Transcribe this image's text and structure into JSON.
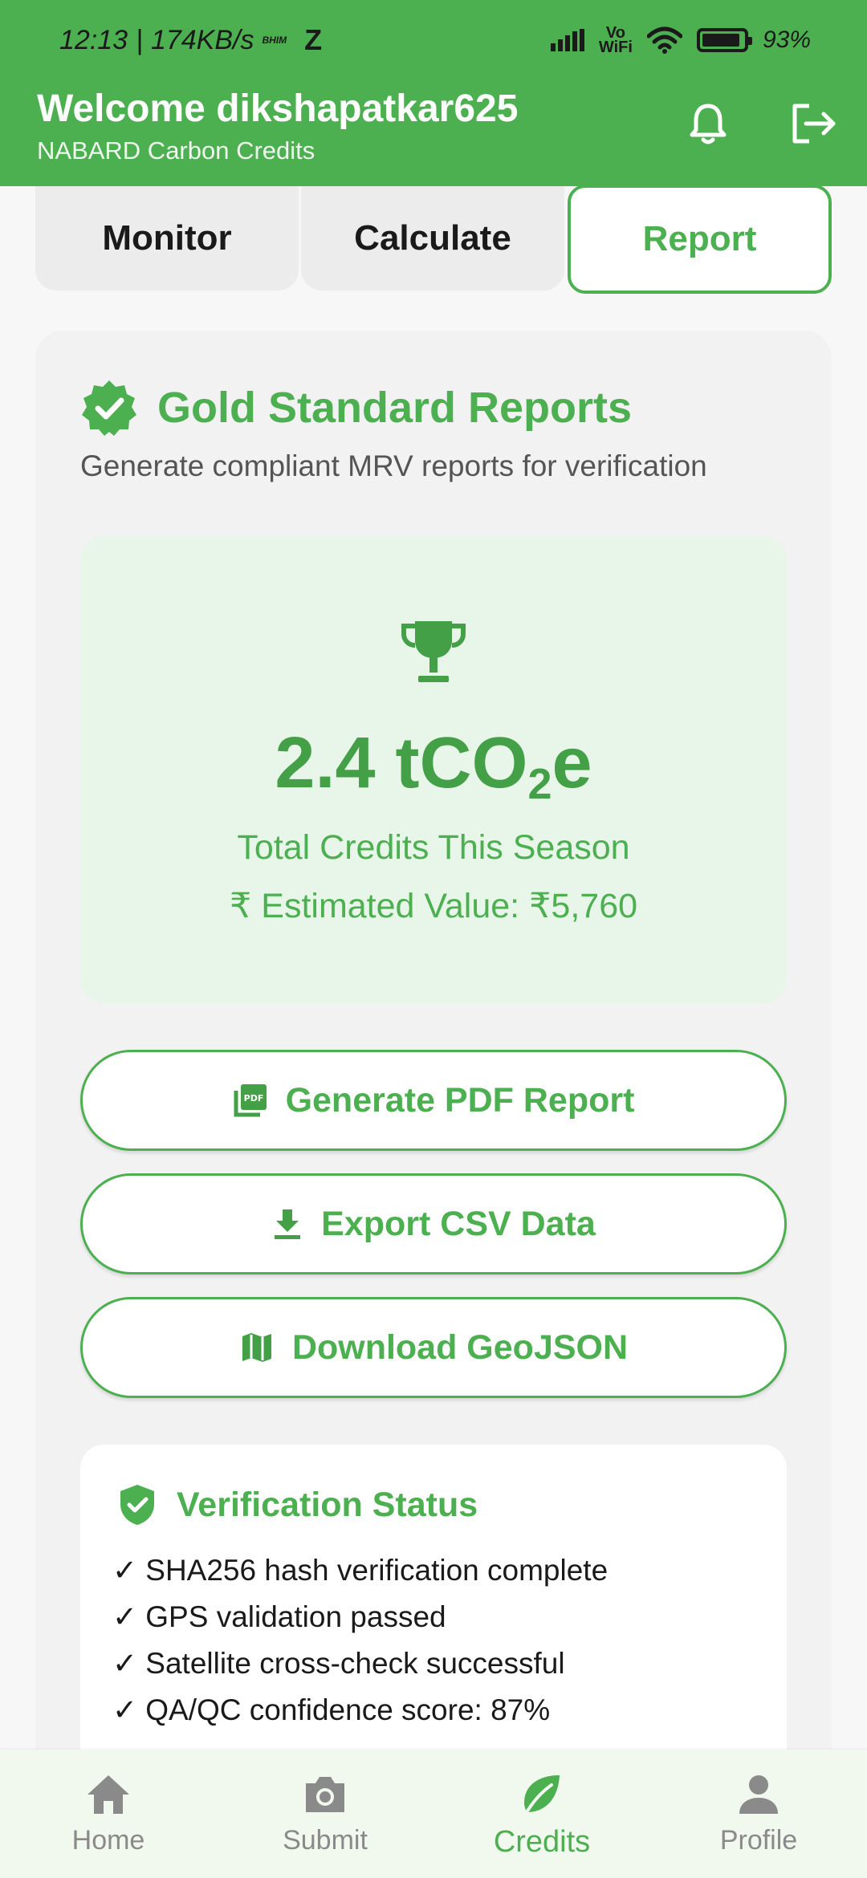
{
  "status_bar": {
    "time": "12:13",
    "separator": "|",
    "speed": "174KB/s",
    "carrier_mark": "BHIM",
    "app_letter": "Z",
    "vowifi_top": "Vo",
    "vowifi_bottom": "WiFi",
    "battery": "93%"
  },
  "header": {
    "welcome": "Welcome dikshapatkar625",
    "subtitle": "NABARD Carbon Credits",
    "bell_icon": "bell-icon",
    "logout_icon": "logout-icon"
  },
  "tabs": [
    {
      "label": "Monitor"
    },
    {
      "label": "Calculate"
    },
    {
      "label": "Report"
    }
  ],
  "report": {
    "title": "Gold Standard Reports",
    "description": "Generate compliant MRV reports for verification",
    "credit_value_prefix": "2.4 tCO",
    "credit_value_sub": "2",
    "credit_value_suffix": "e",
    "credit_label": "Total Credits This Season",
    "estimated_value": "₹ Estimated Value: ₹5,760"
  },
  "actions": {
    "pdf_label": "Generate PDF Report",
    "csv_label": "Export CSV Data",
    "geojson_label": "Download GeoJSON"
  },
  "verification": {
    "title": "Verification Status",
    "items": [
      "✓ SHA256 hash verification complete",
      "✓ GPS validation passed",
      "✓ Satellite cross-check successful",
      "✓ QA/QC confidence score: 87%"
    ]
  },
  "bottom_nav": [
    {
      "label": "Home",
      "icon": "home-icon"
    },
    {
      "label": "Submit",
      "icon": "camera-icon"
    },
    {
      "label": "Credits",
      "icon": "leaf-icon"
    },
    {
      "label": "Profile",
      "icon": "person-icon"
    }
  ],
  "colors": {
    "primary": "#4caf50",
    "credit_bg": "#e8f5e9",
    "nav_bg": "#f1f8ee"
  }
}
